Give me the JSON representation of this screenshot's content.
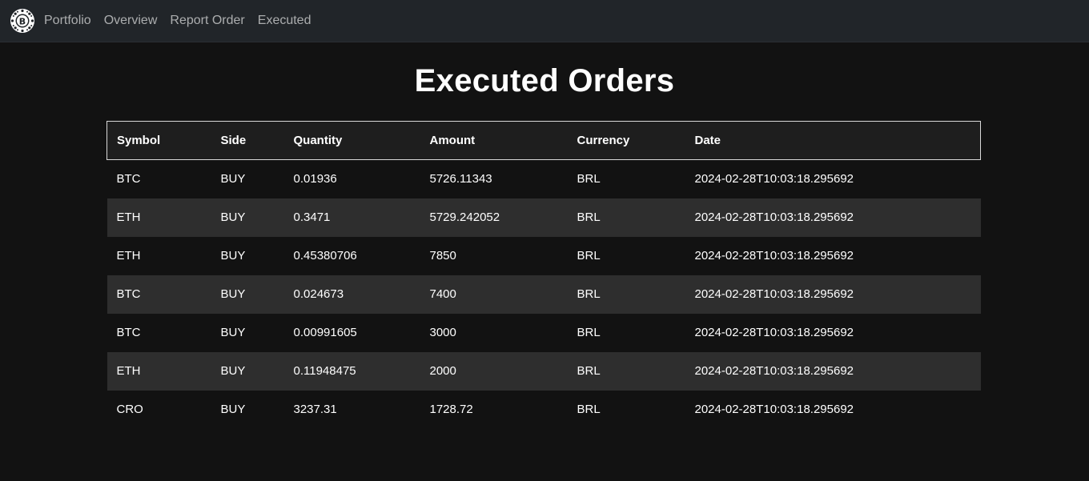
{
  "nav": {
    "logo_icon": "bitcoin-seal-icon",
    "links": [
      "Portfolio",
      "Overview",
      "Report Order",
      "Executed"
    ]
  },
  "page": {
    "title": "Executed Orders"
  },
  "table": {
    "headers": [
      "Symbol",
      "Side",
      "Quantity",
      "Amount",
      "Currency",
      "Date"
    ],
    "rows": [
      [
        "BTC",
        "BUY",
        "0.01936",
        "5726.11343",
        "BRL",
        "2024-02-28T10:03:18.295692"
      ],
      [
        "ETH",
        "BUY",
        "0.3471",
        "5729.242052",
        "BRL",
        "2024-02-28T10:03:18.295692"
      ],
      [
        "ETH",
        "BUY",
        "0.45380706",
        "7850",
        "BRL",
        "2024-02-28T10:03:18.295692"
      ],
      [
        "BTC",
        "BUY",
        "0.024673",
        "7400",
        "BRL",
        "2024-02-28T10:03:18.295692"
      ],
      [
        "BTC",
        "BUY",
        "0.00991605",
        "3000",
        "BRL",
        "2024-02-28T10:03:18.295692"
      ],
      [
        "ETH",
        "BUY",
        "0.11948475",
        "2000",
        "BRL",
        "2024-02-28T10:03:18.295692"
      ],
      [
        "CRO",
        "BUY",
        "3237.31",
        "1728.72",
        "BRL",
        "2024-02-28T10:03:18.295692"
      ]
    ]
  },
  "colors": {
    "background": "#121212",
    "navbar": "#212529",
    "row_striped": "#2e2e2e"
  }
}
